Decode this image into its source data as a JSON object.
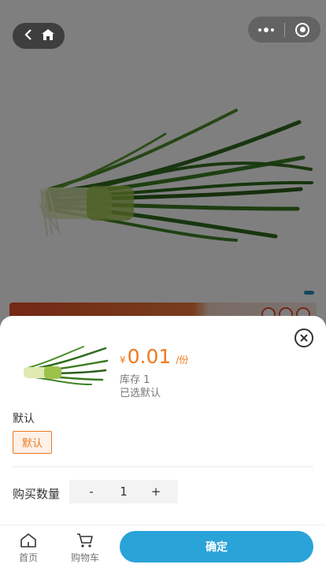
{
  "product": {
    "price_symbol": "¥",
    "price": "0.01",
    "unit": "/份",
    "stock": "库存 1",
    "selected": "已选默认"
  },
  "spec": {
    "title": "默认",
    "options": [
      "默认"
    ],
    "selected_option": "默认"
  },
  "quantity": {
    "label": "购买数量",
    "minus": "-",
    "value": "1",
    "plus": "+"
  },
  "bottom_bar": {
    "home_label": "首页",
    "cart_label": "购物车",
    "confirm_label": "确定"
  },
  "colors": {
    "accent_orange": "#f0791e",
    "confirm_blue": "#2aa3d8",
    "swiper_dot": "#2a8fc1"
  },
  "icons": {
    "nav_back": "back-icon",
    "nav_home": "home-icon",
    "more": "more-dots-icon",
    "exit": "target-icon",
    "close": "close-icon",
    "home_tab": "house-icon",
    "cart_tab": "cart-icon"
  }
}
